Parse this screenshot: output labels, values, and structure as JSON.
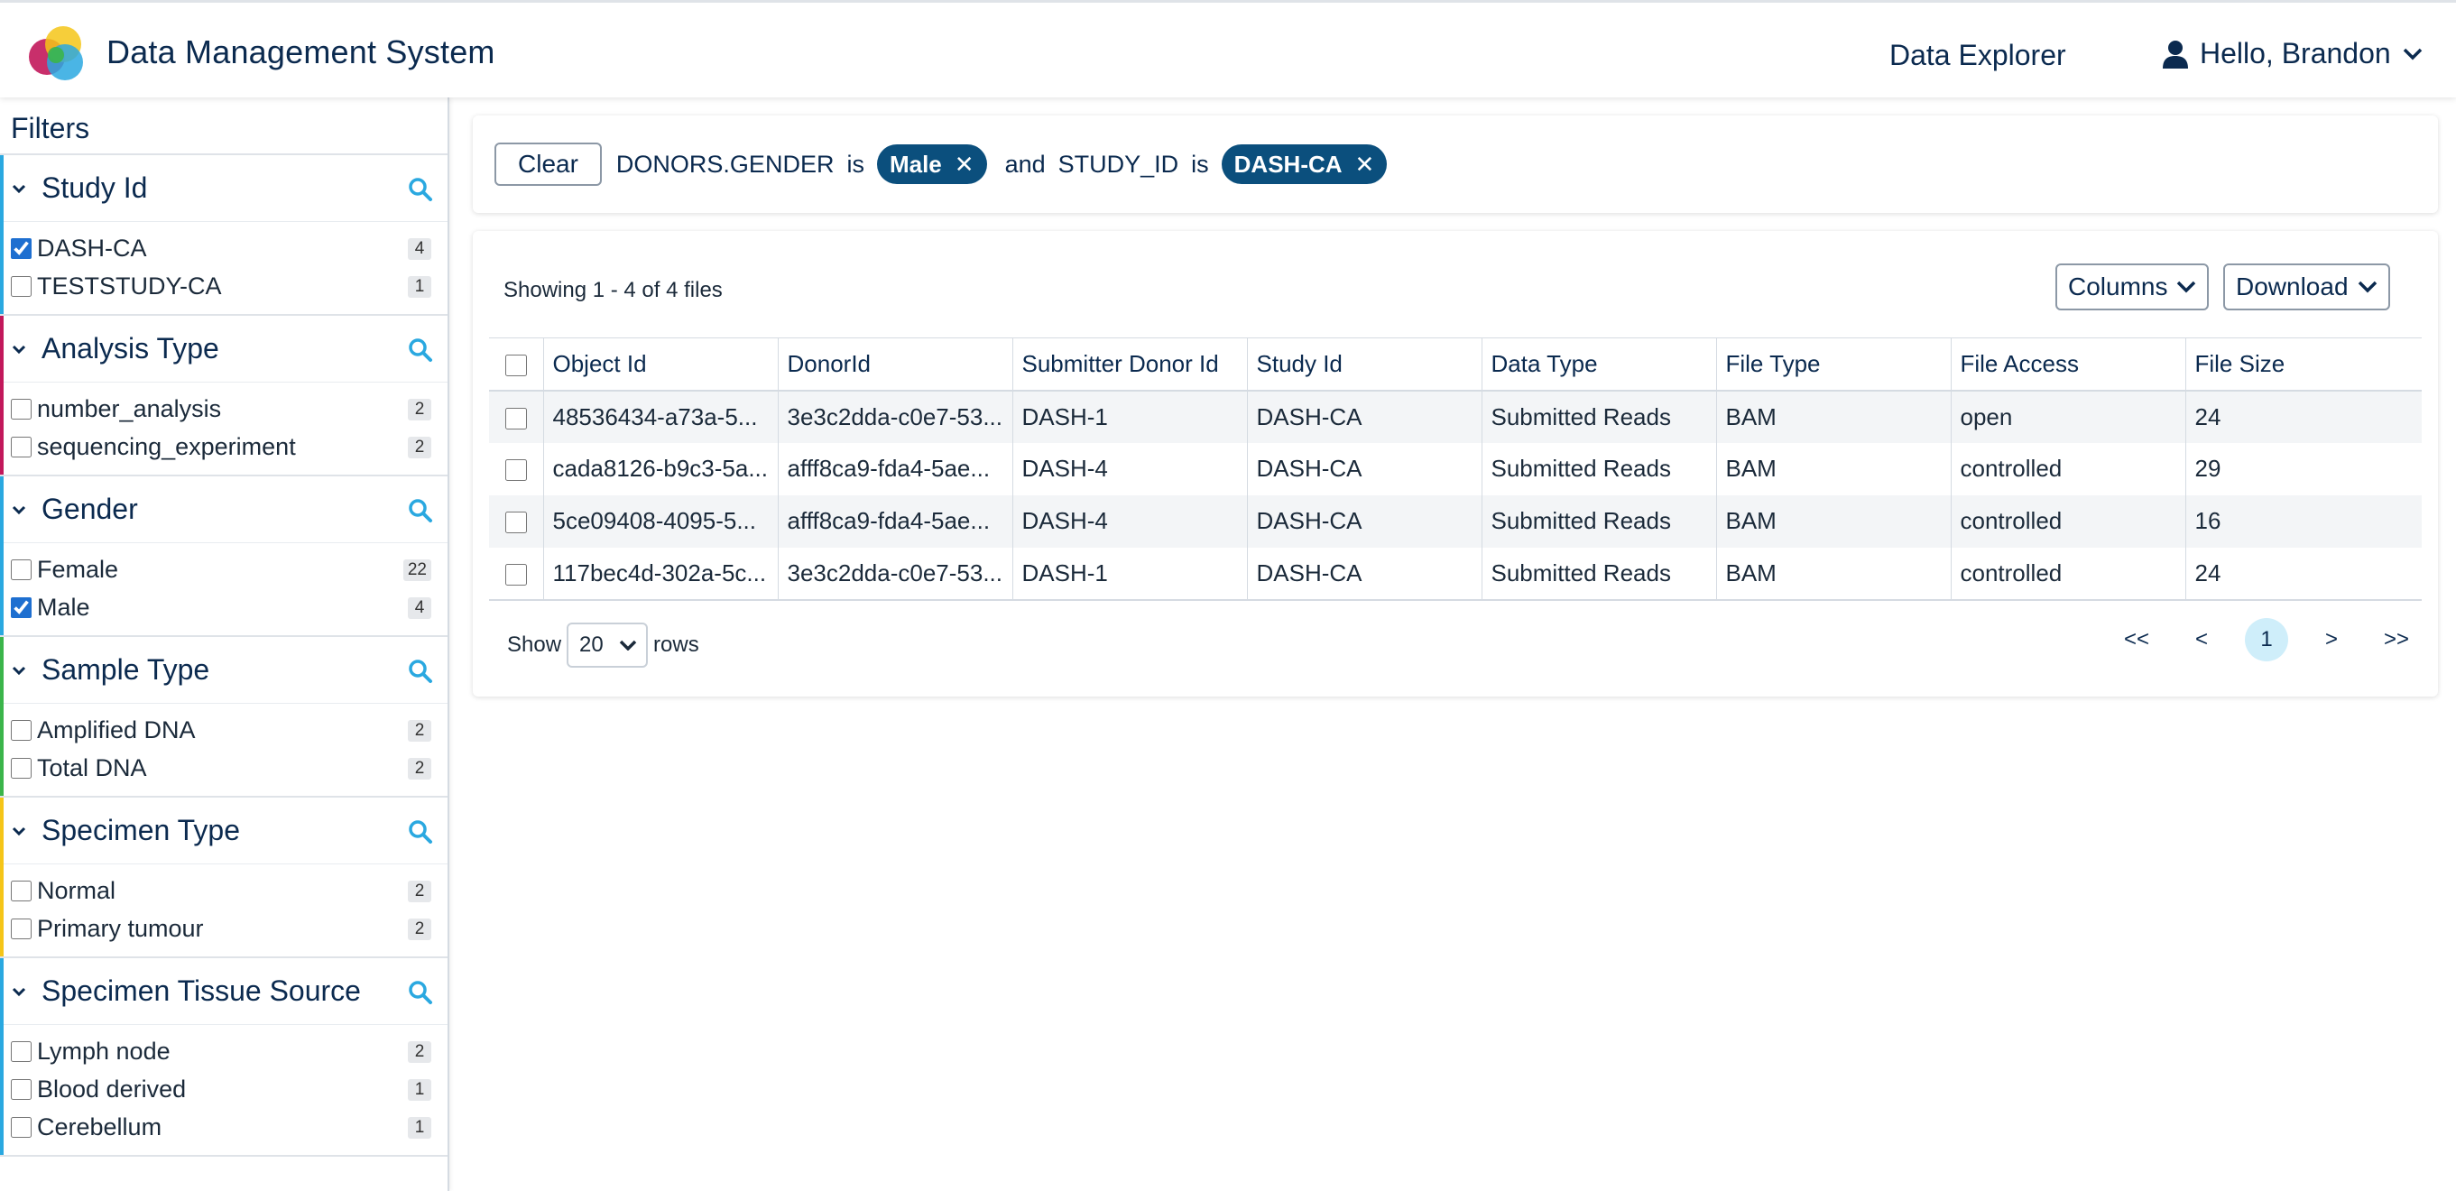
{
  "header": {
    "app_title": "Data Management System",
    "nav_explorer": "Data Explorer",
    "user_greeting": "Hello, Brandon",
    "logo_colors": [
      "#c2185b",
      "#f5c518",
      "#2aa8e0",
      "#3bb54a"
    ]
  },
  "sidebar": {
    "title": "Filters",
    "facets": [
      {
        "title": "Study Id",
        "accent": "#2aa8e0",
        "options": [
          {
            "label": "DASH-CA",
            "count": "4",
            "checked": true
          },
          {
            "label": "TESTSTUDY-CA",
            "count": "1",
            "checked": false
          }
        ]
      },
      {
        "title": "Analysis Type",
        "accent": "#c2185b",
        "options": [
          {
            "label": "number_analysis",
            "count": "2",
            "checked": false
          },
          {
            "label": "sequencing_experiment",
            "count": "2",
            "checked": false
          }
        ]
      },
      {
        "title": "Gender",
        "accent": "#2aa8e0",
        "options": [
          {
            "label": "Female",
            "count": "22",
            "checked": false
          },
          {
            "label": "Male",
            "count": "4",
            "checked": true
          }
        ]
      },
      {
        "title": "Sample Type",
        "accent": "#3bb54a",
        "options": [
          {
            "label": "Amplified DNA",
            "count": "2",
            "checked": false
          },
          {
            "label": "Total DNA",
            "count": "2",
            "checked": false
          }
        ]
      },
      {
        "title": "Specimen Type",
        "accent": "#f5c518",
        "options": [
          {
            "label": "Normal",
            "count": "2",
            "checked": false
          },
          {
            "label": "Primary tumour",
            "count": "2",
            "checked": false
          }
        ]
      },
      {
        "title": "Specimen Tissue Source",
        "accent": "#2aa8e0",
        "options": [
          {
            "label": "Lymph node",
            "count": "2",
            "checked": false
          },
          {
            "label": "Blood derived",
            "count": "1",
            "checked": false
          },
          {
            "label": "Cerebellum",
            "count": "1",
            "checked": false
          }
        ]
      }
    ]
  },
  "sqon": {
    "clear_label": "Clear",
    "field1": "DONORS.GENDER",
    "op1": "is",
    "value1": "Male",
    "combinator": "and",
    "field2": "STUDY_ID",
    "op2": "is",
    "value2": "DASH-CA"
  },
  "table": {
    "showing": "Showing 1 - 4 of 4 files",
    "columns_button": "Columns",
    "download_button": "Download",
    "headers": [
      "Object Id",
      "DonorId",
      "Submitter Donor Id",
      "Study Id",
      "Data Type",
      "File Type",
      "File Access",
      "File Size"
    ],
    "rows": [
      [
        "48536434-a73a-5...",
        "3e3c2dda-c0e7-53...",
        "DASH-1",
        "DASH-CA",
        "Submitted Reads",
        "BAM",
        "open",
        "24"
      ],
      [
        "cada8126-b9c3-5a...",
        "afff8ca9-fda4-5ae...",
        "DASH-4",
        "DASH-CA",
        "Submitted Reads",
        "BAM",
        "controlled",
        "29"
      ],
      [
        "5ce09408-4095-5...",
        "afff8ca9-fda4-5ae...",
        "DASH-4",
        "DASH-CA",
        "Submitted Reads",
        "BAM",
        "controlled",
        "16"
      ],
      [
        "117bec4d-302a-5c...",
        "3e3c2dda-c0e7-53...",
        "DASH-1",
        "DASH-CA",
        "Submitted Reads",
        "BAM",
        "controlled",
        "24"
      ]
    ]
  },
  "pagination": {
    "show_label": "Show",
    "rows_value": "20",
    "rows_label": "rows",
    "first": "<<",
    "prev": "<",
    "current": "1",
    "next": ">",
    "last": ">>"
  }
}
